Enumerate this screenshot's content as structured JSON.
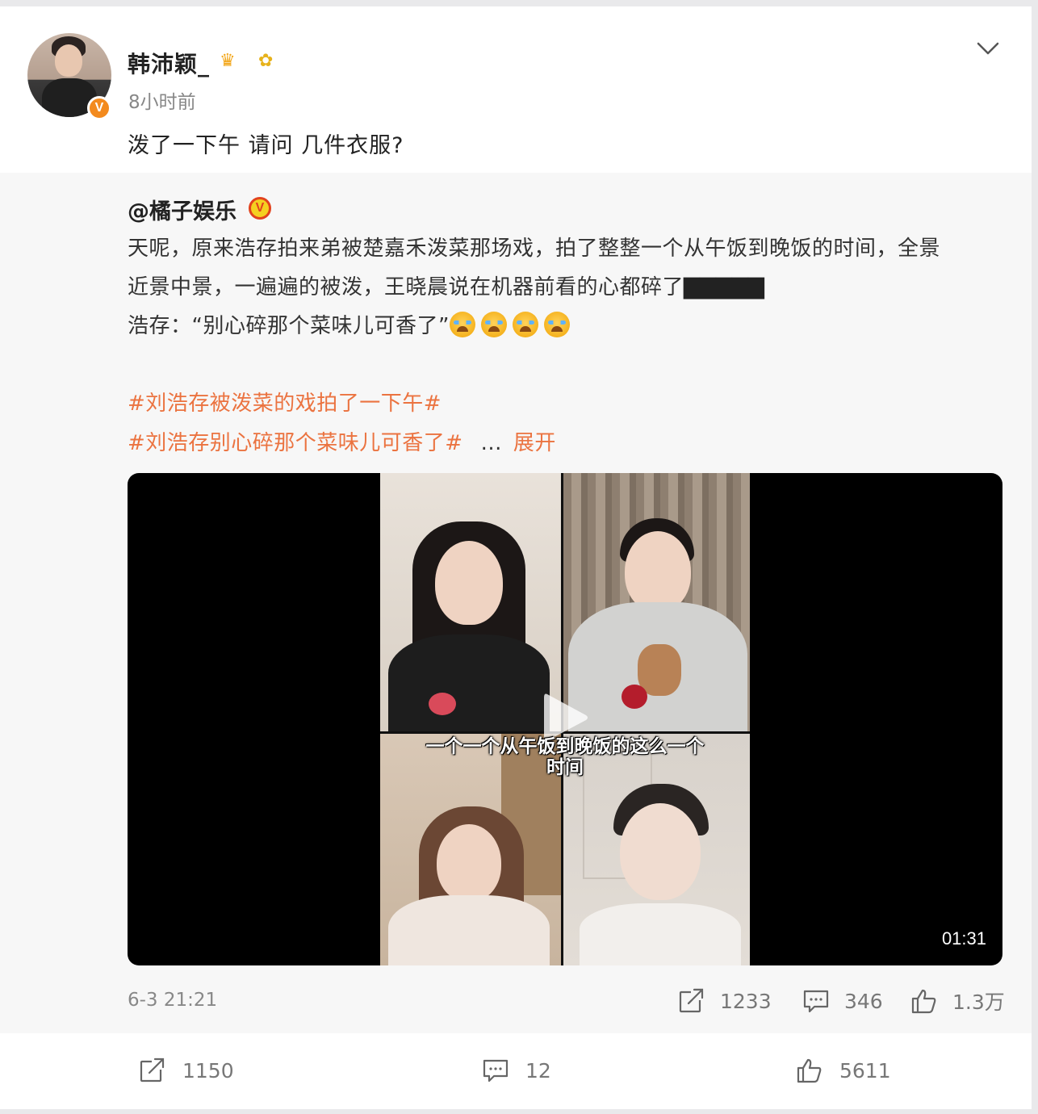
{
  "post": {
    "username": "韩沛颖_",
    "time_ago": "8小时前",
    "text": "泼了一下午 请问 几件衣服?",
    "badges": {
      "verify": "V",
      "crown": "♛",
      "flower": "✿"
    },
    "icons": [
      "crown-icon",
      "sunflower-icon",
      "chevron-down-icon"
    ]
  },
  "repost": {
    "author": "@橘子娱乐",
    "author_badge": "V",
    "body_lines": [
      "天呢，原来浩存拍来弟被楚嘉禾泼菜那场戏，拍了整整一个从午饭到晚饭的时间，全景",
      "近景中景，一遍遍的被泼，王晓晨说在机器前看的心都碎了",
      "浩存：“别心碎那个菜味儿可香了”"
    ],
    "blocks_glyphs": "▇▇▇▇▇",
    "hashtags": [
      "#刘浩存被泼菜的戏拍了一下午#",
      "#刘浩存别心碎那个菜味儿可香了#"
    ],
    "ellipsis": "...",
    "expand": "展开",
    "video": {
      "subtitle_line1": "一个一个从午饭到晚饭的这么一个",
      "subtitle_line2": "时间",
      "duration": "01:31"
    },
    "date": "6-3 21:21",
    "reposts": "1233",
    "comments": "346",
    "likes": "1.3万"
  },
  "actions": {
    "reposts": "1150",
    "comments": "12",
    "likes": "5611"
  },
  "colors": {
    "hashtag": "#eb7340",
    "repost_bg": "#f7f7f7",
    "verify_orange": "#f38a1e"
  }
}
